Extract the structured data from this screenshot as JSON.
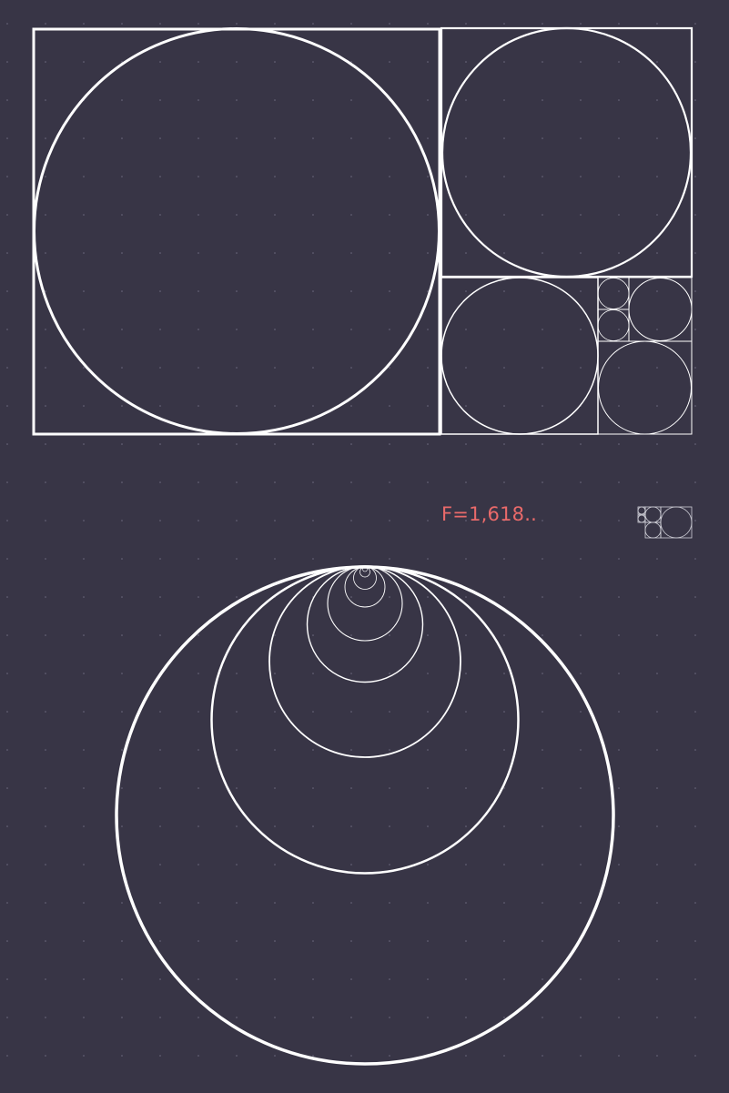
{
  "ratio_label": "F=1,618..",
  "colors": {
    "background": "#383546",
    "stroke": "#ffffff",
    "accent": "#ea6a6a",
    "grid_dot": "#6e6b80"
  },
  "diagram": {
    "type": "golden-ratio-construction",
    "ratio": 1.618,
    "parts": [
      "golden-rectangle-with-inscribed-circles",
      "small-golden-rectangle-thumbnail",
      "nested-tangent-circles"
    ]
  }
}
